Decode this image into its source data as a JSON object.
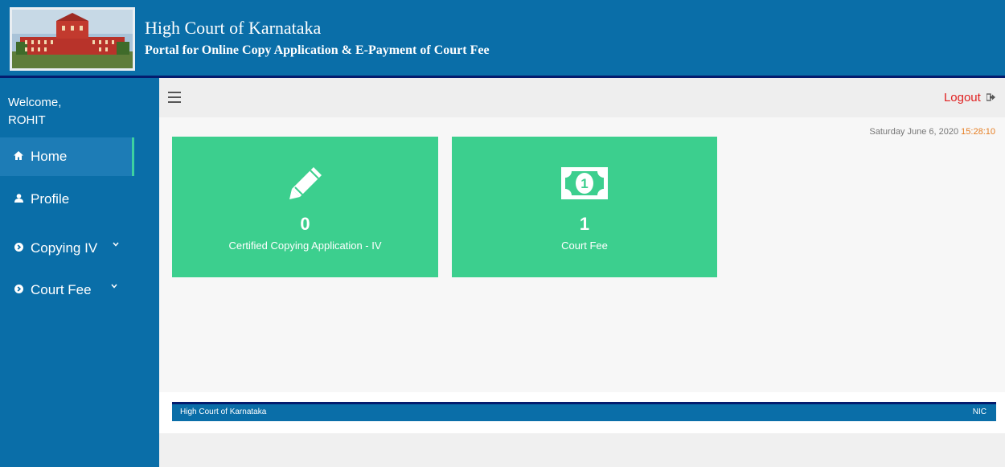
{
  "header": {
    "title": "High Court of Karnataka",
    "subtitle": "Portal for Online Copy Application & E-Payment of Court Fee"
  },
  "sidebar": {
    "welcome": "Welcome,",
    "user": "ROHIT",
    "items": [
      {
        "label": "Home",
        "icon": "home-icon"
      },
      {
        "label": "Profile",
        "icon": "user-icon"
      },
      {
        "label": "Copying IV",
        "icon": "circle-arrow-icon"
      },
      {
        "label": "Court Fee",
        "icon": "circle-arrow-icon"
      }
    ]
  },
  "topbar": {
    "logout": "Logout"
  },
  "content": {
    "date": "Saturday June 6, 2020",
    "time": "15:28:10",
    "cards": [
      {
        "count": "0",
        "label": "Certified Copying Application - IV",
        "icon": "pencil-icon"
      },
      {
        "count": "1",
        "label": "Court Fee",
        "icon": "money-icon"
      }
    ]
  },
  "footer": {
    "left": "High Court of Karnataka",
    "right": "NIC"
  },
  "colors": {
    "header": "#0a6ea8",
    "card": "#3ccf8e",
    "logout": "#e02020",
    "time": "#e67e22"
  }
}
